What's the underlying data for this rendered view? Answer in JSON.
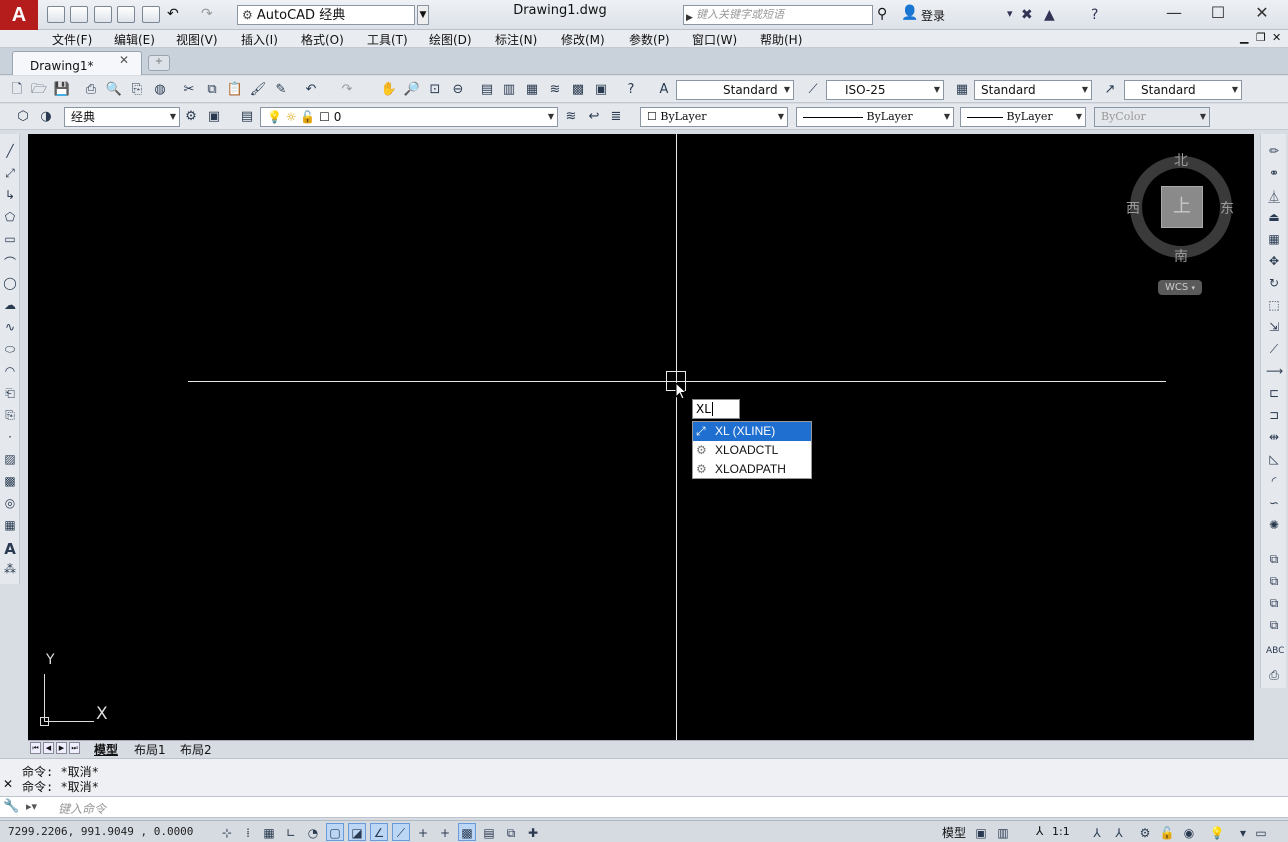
{
  "title_bar": {
    "app_logo": "A",
    "workspace": "AutoCAD 经典",
    "document_title": "Drawing1.dwg",
    "search_placeholder": "键入关键字或短语",
    "login_label": "登录",
    "window_minimize": "—",
    "window_maximize": "☐",
    "window_close": "✕"
  },
  "menu": {
    "items": [
      "文件(F)",
      "编辑(E)",
      "视图(V)",
      "插入(I)",
      "格式(O)",
      "工具(T)",
      "绘图(D)",
      "标注(N)",
      "修改(M)",
      "参数(P)",
      "窗口(W)",
      "帮助(H)"
    ]
  },
  "tabs": {
    "drawing_tab": "Drawing1*",
    "close_glyph": "✕"
  },
  "toolbar_styles": {
    "text_style": "Standard",
    "dim_style": "ISO-25",
    "table_style": "Standard",
    "multileader_style": "Standard"
  },
  "toolbar_layers": {
    "workspace_combo": "经典",
    "layer_name": "0",
    "color": "ByLayer",
    "linetype": "ByLayer",
    "lineweight": "ByLayer",
    "plot_style": "ByColor"
  },
  "viewcube": {
    "north": "北",
    "south": "南",
    "east": "东",
    "west": "西",
    "face": "上",
    "wcs_label": "WCS"
  },
  "ucs": {
    "x_label": "X",
    "y_label": "Y"
  },
  "dynamic_input": {
    "typed_value": "XL",
    "suggestions": [
      "XL (XLINE)",
      "XLOADCTL",
      "XLOADPATH"
    ],
    "selected_index": 0
  },
  "layout_tabs": {
    "model": "模型",
    "layout1": "布局1",
    "layout2": "布局2"
  },
  "command_history": [
    "命令: *取消*",
    "命令: *取消*"
  ],
  "command_line": {
    "placeholder": "键入命令"
  },
  "status_bar": {
    "coordinates": "7299.2206, 991.9049 , 0.0000",
    "model_label": "模型",
    "annotation_scale": "1:1"
  }
}
